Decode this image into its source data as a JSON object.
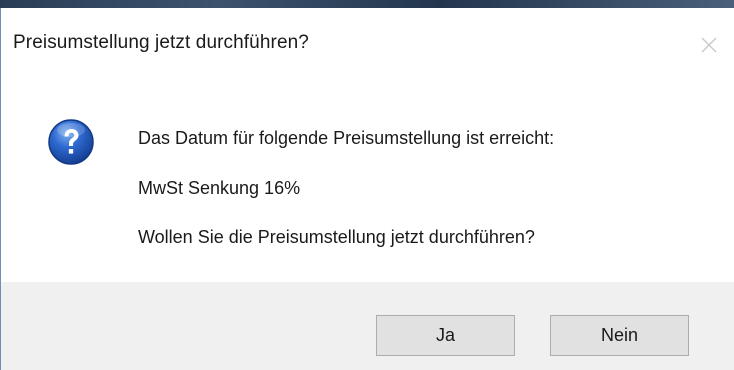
{
  "dialog": {
    "title": "Preisumstellung jetzt durchführen?",
    "icon": "question-icon",
    "messages": [
      "Das Datum für folgende Preisumstellung ist erreicht:",
      "MwSt Senkung 16%",
      "Wollen Sie die Preisumstellung jetzt durchführen?"
    ],
    "buttons": {
      "yes_label": "Ja",
      "no_label": "Nein"
    }
  },
  "colors": {
    "accent_border": "#6d8fb8",
    "icon_blue": "#1f55b8",
    "button_area": "#f0f0f0"
  }
}
